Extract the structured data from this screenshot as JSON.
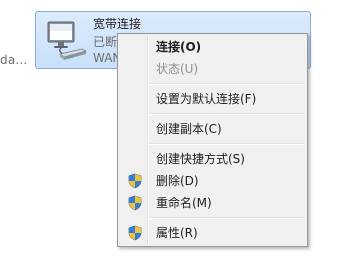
{
  "background": {
    "truncated_text": "da..."
  },
  "connection": {
    "title": "宽带连接",
    "status": "已断",
    "device": "WAN",
    "icon": "network-computer-icon"
  },
  "context_menu": {
    "items": [
      {
        "label": "连接(O)",
        "bold": true,
        "disabled": false,
        "shield": false
      },
      {
        "label": "状态(U)",
        "bold": false,
        "disabled": true,
        "shield": false
      },
      {
        "label": "设置为默认连接(F)",
        "bold": false,
        "disabled": false,
        "shield": false
      },
      {
        "label": "创建副本(C)",
        "bold": false,
        "disabled": false,
        "shield": false
      },
      {
        "label": "创建快捷方式(S)",
        "bold": false,
        "disabled": false,
        "shield": false
      },
      {
        "label": "删除(D)",
        "bold": false,
        "disabled": false,
        "shield": true
      },
      {
        "label": "重命名(M)",
        "bold": false,
        "disabled": false,
        "shield": true
      },
      {
        "label": "属性(R)",
        "bold": false,
        "disabled": false,
        "shield": true
      }
    ],
    "shield_icon": "uac-shield-icon"
  },
  "colors": {
    "selection_border": "#84acdd",
    "selection_fill": "#c8e0fb",
    "menu_background": "#f0f0f0",
    "disabled_text": "#8f8f8f"
  }
}
